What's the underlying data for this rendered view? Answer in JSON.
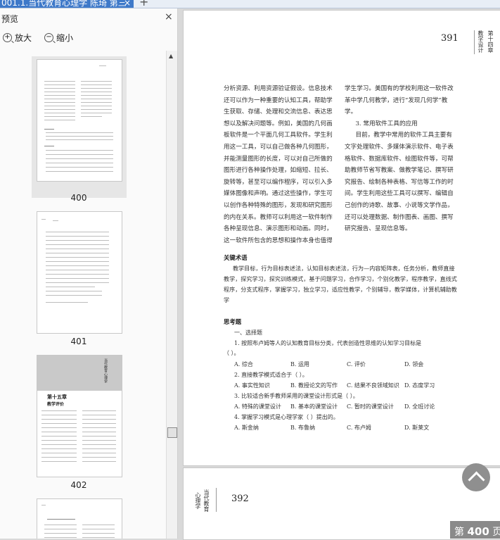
{
  "tab": {
    "title": "001.1.当代教育心理学 陈琦 第三",
    "close": "×",
    "add": "+"
  },
  "panel": {
    "title": "预览",
    "close": "×",
    "zoom_in": "放大",
    "zoom_out": "缩小"
  },
  "thumbnails": [
    {
      "label": "400",
      "selected": true
    },
    {
      "label": "401",
      "selected": false
    },
    {
      "label": "402",
      "selected": false
    },
    {
      "label": "",
      "selected": false
    }
  ],
  "thumb402": {
    "chapter": "第十五章",
    "subtitle": "教学评价",
    "tag": "当代教育心理学"
  },
  "page": {
    "number": "391",
    "side_title_a": "第十四章",
    "side_title_b": "教学设计",
    "left_col": [
      "分析资源、利用资源验证假设。信息技术还可以作为一种重要的认知工具，帮助学生获取、存储、处理和交流信息、表达思想以及解决问题等。例如，美国的几何画板软件是一个平面几何工具软件。学生利用这一工具，可以自己做各种几何图形，并能测量图形的长度，可以对自己所做的图形进行各种操作处理，如缩短、拉长、旋转等，甚至可以编作程序，可以引入多媒体图像和声响。通过这些操作，学生可以创作各种特殊的图形，发现和研究图形的内在关系。教师可以利用这一软件制作各种呈现信息、演示图形和动画。同时，这一软件所包含的思想和操作本身也值得"
    ],
    "right_col_1": "学生学习。美国有的学校利用这一软件改革中学几何教学，进行“发现几何学”教学。",
    "right_col_head": "3. 常用软件工具的应用",
    "right_col_2": "目前，教学中常用的软件工具主要有文字处理软件、多媒体演示软件、电子表格软件、数据库软件、绘图软件等，可帮助教师节省写教案、做教学笔记、撰写研究报告、绘制各种表格、写信等工作的时间。学生利用这些工具可以撰写、编辑自己创作的诗歌、故事、小说等文学作品，还可以处理数据、制作图表、画图、撰写研究报告、呈现信息等。",
    "keywords_head": "关键术语",
    "keywords": "教学目标，行为目标表述法，认知目标表述法，行为—内容矩阵表，任务分析，教师直接教学，探究学习，探究训练模式，基于问题学习，合作学习，个别化教学，程序教学，直线式程序，分支式程序，掌握学习，独立学习，适应性教学，个别辅导，教学媒体，计算机辅助教学",
    "questions_head": "思考题",
    "section_1": "一、选择题",
    "q1": "1. 按照布卢姆等人的认知教育目标分类，代表创造性思维的认知学习目标是",
    "q1b": "（    ）。",
    "q1_opts": [
      "A. 综合",
      "B. 运用",
      "C. 评价",
      "D. 领会"
    ],
    "q2": "2. 直接教学模式适合于（    ）。",
    "q2_opts": [
      "A. 事实性知识",
      "B. 教授论文的写作",
      "C. 结果不良领域知识",
      "D. 态度学习"
    ],
    "q3": "3. 比较适合新手教师采用的课堂设计形式是（    ）。",
    "q3_opts": [
      "A. 特殊的课堂设计",
      "B. 基本的课堂设计",
      "C. 暂时的课堂设计",
      "D. 全班讨论"
    ],
    "q4": "4. 掌握学习模式是心理学家（    ）提出的。",
    "q4_opts": [
      "A. 斯金纳",
      "B. 布鲁纳",
      "C. 布卢姆",
      "D. 斯莱文"
    ]
  },
  "page2": {
    "number": "392",
    "side_a": "当代教育",
    "side_b": "心理学"
  },
  "badge": {
    "prefix": "第",
    "number": "400",
    "suffix": "页"
  }
}
